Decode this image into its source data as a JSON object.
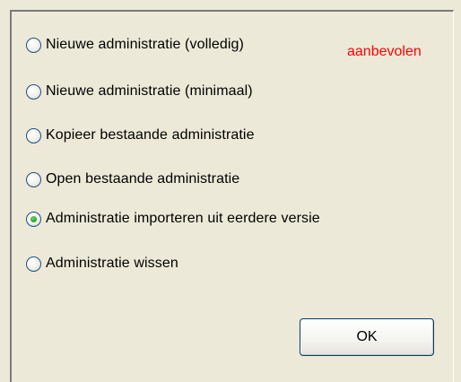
{
  "options": [
    {
      "label": "Nieuwe administratie (volledig)",
      "checked": false
    },
    {
      "label": "Nieuwe administratie (minimaal)",
      "checked": false
    },
    {
      "label": "Kopieer bestaande administratie",
      "checked": false
    },
    {
      "label": "Open bestaande administratie",
      "checked": false
    },
    {
      "label": "Administratie importeren uit eerdere versie",
      "checked": true
    },
    {
      "label": "Administratie wissen",
      "checked": false
    }
  ],
  "recommended_label": "aanbevolen",
  "recommended_color": "#ff0000",
  "ok_label": "OK"
}
